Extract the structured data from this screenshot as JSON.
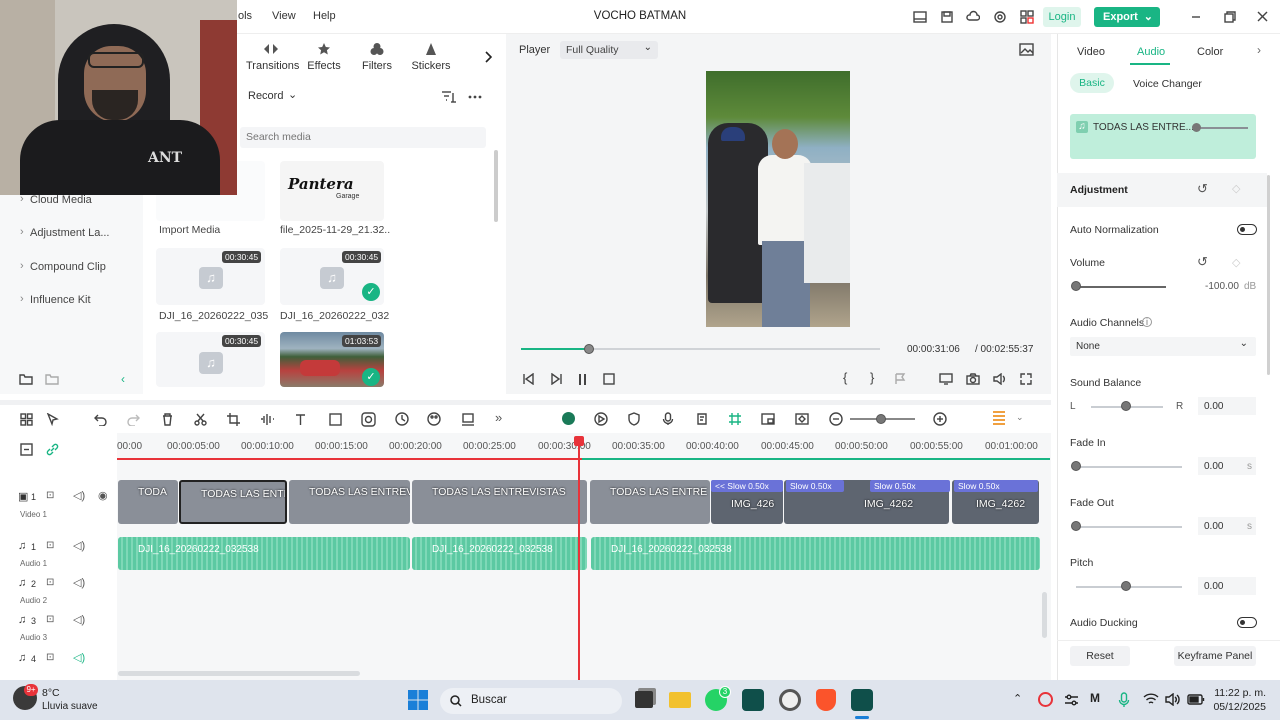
{
  "titlebar": {
    "menu_tools": "ols",
    "menu_view": "View",
    "menu_help": "Help",
    "title": "VOCHO BATMAN",
    "login": "Login",
    "export": "Export"
  },
  "tools": {
    "transitions": "Transitions",
    "effects": "Effects",
    "filters": "Filters",
    "stickers": "Stickers"
  },
  "media": {
    "record": "Record",
    "search_placeholder": "Search media",
    "items": [
      {
        "label": "Import Media"
      },
      {
        "label": "file_2025-11-29_21.32...",
        "logo_text": "Pantera Garage"
      },
      {
        "label": "DJI_16_20260222_035...",
        "duration": "00:30:45"
      },
      {
        "label": "DJI_16_20260222_032...",
        "duration": "00:30:45"
      },
      {
        "label": "",
        "duration": "00:30:45"
      },
      {
        "label": "",
        "duration": "01:03:53"
      }
    ]
  },
  "sidebar": {
    "items": [
      "Cloud Media",
      "Adjustment La...",
      "Compound Clip",
      "Influence Kit"
    ]
  },
  "player": {
    "label": "Player",
    "quality": "Full Quality",
    "current_time": "00:00:31:06",
    "total_time": "/ 00:02:55:37",
    "progress": 0.19
  },
  "right": {
    "tabs": [
      "Video",
      "Audio",
      "Color"
    ],
    "active_tab": "Audio",
    "subtabs": [
      "Basic",
      "Voice Changer"
    ],
    "clip_name": "TODAS LAS ENTRE...",
    "adjustment": "Adjustment",
    "auto_normalization": "Auto Normalization",
    "volume": "Volume",
    "volume_value": "-100.00",
    "volume_unit": "dB",
    "audio_channels": "Audio Channels",
    "channels_value": "None",
    "sound_balance": "Sound Balance",
    "balance_l": "L",
    "balance_r": "R",
    "balance_value": "0.00",
    "fade_in": "Fade In",
    "fade_in_value": "0.00",
    "fade_in_unit": "s",
    "fade_out": "Fade Out",
    "fade_out_value": "0.00",
    "fade_out_unit": "s",
    "pitch": "Pitch",
    "pitch_value": "0.00",
    "audio_ducking": "Audio Ducking",
    "reset": "Reset",
    "keyframe": "Keyframe Panel"
  },
  "timeline": {
    "ruler": [
      "00:00",
      "00:00:05:00",
      "00:00:10:00",
      "00:00:15:00",
      "00:00:20:00",
      "00:00:25:00",
      "00:00:30:00",
      "00:00:35:00",
      "00:00:40:00",
      "00:00:45:00",
      "00:00:50:00",
      "00:00:55:00",
      "00:01:00:00"
    ],
    "tracks": [
      {
        "num": "1",
        "name": "Video 1"
      },
      {
        "num": "1",
        "name": "Audio 1"
      },
      {
        "num": "2",
        "name": "Audio 2"
      },
      {
        "num": "3",
        "name": "Audio 3"
      },
      {
        "num": "4",
        "name": ""
      }
    ],
    "video_clips": [
      "TODA",
      "TODAS LAS ENTRE",
      "TODAS LAS ENTREVI",
      "TODAS LAS ENTREVISTAS",
      "TODAS LAS ENTRE",
      "IMG_426",
      "IMG_4262",
      "IMG_4262"
    ],
    "speed_labels": [
      "<< Slow 0.50x",
      "Slow 0.50x",
      "Slow 0.50x",
      "Slow 0.50x"
    ],
    "audio_clips": [
      "DJI_16_20260222_032538",
      "DJI_16_20260222_032538",
      "DJI_16_20260222_032538"
    ]
  },
  "taskbar": {
    "temp": "8°C",
    "weather": "Lluvia suave",
    "search": "Buscar",
    "time": "11:22 p. m.",
    "date": "05/12/2025",
    "badge": "9+",
    "whatsapp_badge": "3"
  },
  "colors": {
    "accent": "#19b584",
    "playhead": "#e8333a",
    "audio_clip": "#5cc9a2",
    "speed": "#6a72d8"
  }
}
